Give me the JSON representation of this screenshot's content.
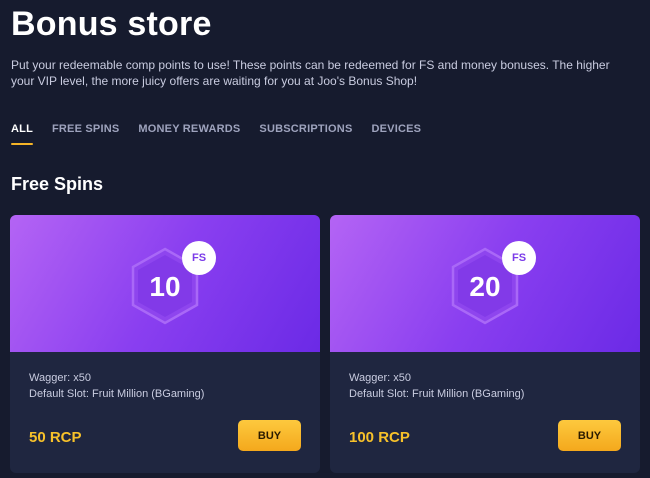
{
  "page": {
    "title": "Bonus store",
    "intro": "Put your redeemable comp points to use! These points can be redeemed for FS and money bonuses. The higher your VIP level, the more juicy offers are waiting for you at Joo's Bonus Shop!"
  },
  "tabs": [
    {
      "label": "ALL",
      "active": true
    },
    {
      "label": "FREE SPINS",
      "active": false
    },
    {
      "label": "MONEY REWARDS",
      "active": false
    },
    {
      "label": "SUBSCRIPTIONS",
      "active": false
    },
    {
      "label": "DEVICES",
      "active": false
    }
  ],
  "section": {
    "title": "Free Spins"
  },
  "cards": [
    {
      "amount": "10",
      "badge": "FS",
      "wagger": "Wagger: x50",
      "slot": "Default Slot: Fruit Million (BGaming)",
      "price": "50 RCP",
      "buy_label": "BUY"
    },
    {
      "amount": "20",
      "badge": "FS",
      "wagger": "Wagger: x50",
      "slot": "Default Slot: Fruit Million (BGaming)",
      "price": "100 RCP",
      "buy_label": "BUY"
    }
  ],
  "colors": {
    "background": "#161b2e",
    "card": "#1f2640",
    "accent": "#f5b427",
    "price": "#f7c12a",
    "hero_gradient": [
      "#b464f4",
      "#6b2ae6"
    ]
  },
  "icons": {
    "amount_shape": "hexagon-icon"
  }
}
